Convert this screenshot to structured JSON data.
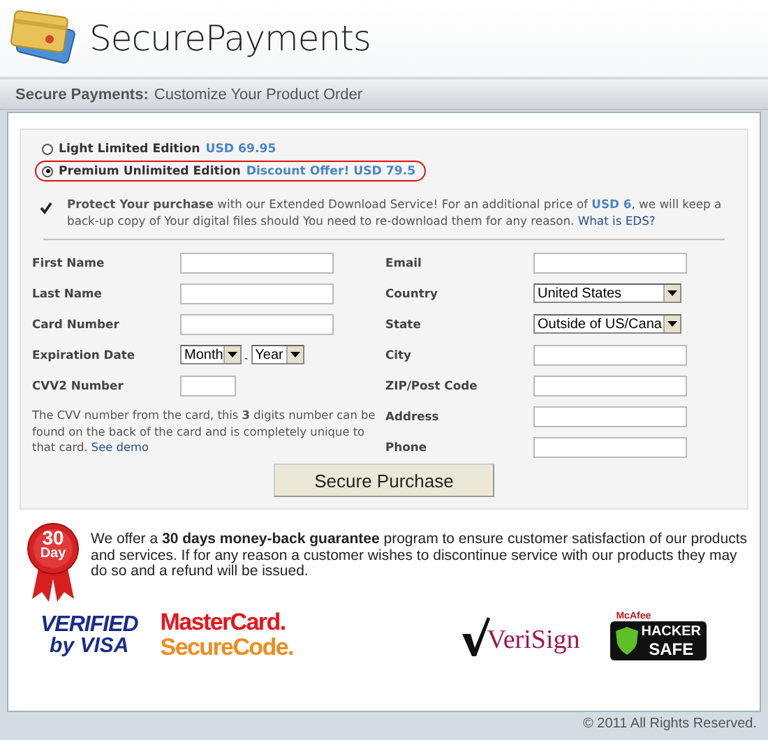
{
  "header": {
    "title": "SecurePayments"
  },
  "title_bar": {
    "label": "Secure Payments:",
    "text": "Customize Your Product Order"
  },
  "editions": [
    {
      "name": "Light Limited Edition",
      "offer": "USD 69.95",
      "selected": false,
      "highlighted": false
    },
    {
      "name": "Premium Unlimited Edition",
      "offer": "Discount Offer! USD 79.5",
      "selected": true,
      "highlighted": true
    }
  ],
  "protection": {
    "checked": true,
    "text": "**Protect Your purchase** with our Extended Download Service! For an additional price of *USD 6*, we will keep a back-up copy of Your digital files should You need to re-download them for any reason.",
    "link": "What is EDS?"
  },
  "form": {
    "left": [
      {
        "label": "First Name",
        "kind": "text"
      },
      {
        "label": "Last Name",
        "kind": "text"
      },
      {
        "label": "Card Number",
        "kind": "text"
      },
      {
        "label": "Expiration Date",
        "kind": "selects",
        "options": [
          "Month",
          "Year"
        ],
        "separator": "-"
      },
      {
        "label": "CVV2 Number",
        "kind": "short"
      }
    ],
    "note": {
      "text": "The CVV number from the card, this **3** digits number can be found on the back of the card and is completely unique to that card.",
      "link": "See demo"
    },
    "right": [
      {
        "label": "Email",
        "kind": "text"
      },
      {
        "label": "Country",
        "kind": "select",
        "value": "United States"
      },
      {
        "label": "State",
        "kind": "select",
        "value": "Outside of US/Cana"
      },
      {
        "label": "City",
        "kind": "text"
      },
      {
        "label": "ZIP/Post Code",
        "kind": "text"
      },
      {
        "label": "Address",
        "kind": "text"
      },
      {
        "label": "Phone",
        "kind": "text"
      }
    ]
  },
  "submit": "Secure Purchase",
  "guarantee": {
    "badge": [
      "30",
      "Day"
    ],
    "text": "We offer a **30 days money-back guarantee** program to ensure customer satisfaction of our products and services. If for any reason a customer wishes to discontinue service with our products they may do so and a refund will be issued."
  },
  "logos": [
    {
      "kind": "visa",
      "lines": [
        "VERIFIED",
        "by VISA"
      ]
    },
    {
      "kind": "mastercard",
      "lines": [
        "MasterCard.",
        "SecureCode."
      ]
    },
    {
      "kind": "verisign",
      "lines": [
        "VeriSign"
      ]
    },
    {
      "kind": "hacker",
      "lines": [
        "McAfee",
        "HACKER",
        "SAFE"
      ]
    }
  ],
  "footer": "© 2011 All Rights Reserved."
}
